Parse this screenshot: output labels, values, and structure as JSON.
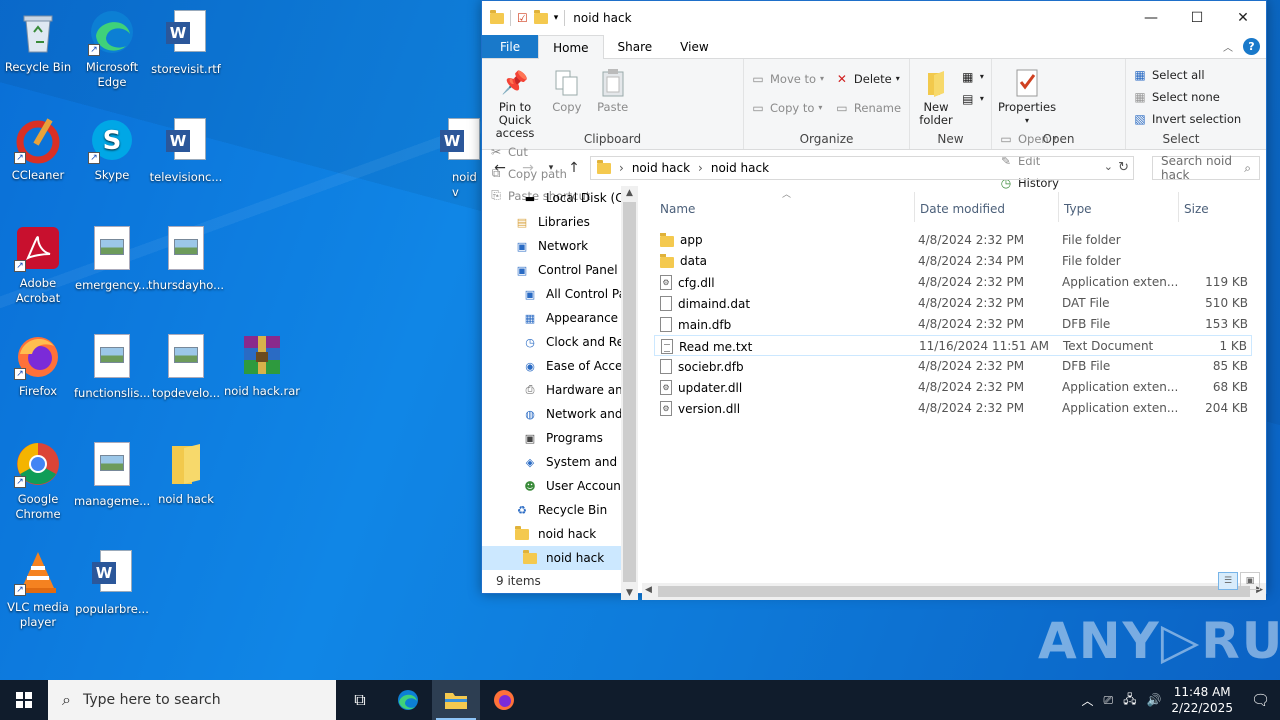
{
  "desktop": {
    "icons": [
      {
        "label": "Recycle Bin"
      },
      {
        "label": "Microsoft Edge"
      },
      {
        "label": "storevisit.rtf"
      },
      {
        "label": "CCleaner"
      },
      {
        "label": "Skype"
      },
      {
        "label": "televisionc..."
      },
      {
        "label": "noid v"
      },
      {
        "label": "Adobe Acrobat"
      },
      {
        "label": "emergency..."
      },
      {
        "label": "thursdayho..."
      },
      {
        "label": "Firefox"
      },
      {
        "label": "functionslis..."
      },
      {
        "label": "topdevelo..."
      },
      {
        "label": "noid hack.rar"
      },
      {
        "label": "Google Chrome"
      },
      {
        "label": "manageme..."
      },
      {
        "label": "noid hack"
      },
      {
        "label": "VLC media player"
      },
      {
        "label": "popularbre..."
      }
    ]
  },
  "window": {
    "title": "noid hack",
    "caption": {
      "minimize": "—",
      "maximize": "☐",
      "close": "✕"
    },
    "tabs": [
      "File",
      "Home",
      "Share",
      "View"
    ],
    "ribbon": {
      "clipboard": {
        "name": "Clipboard",
        "pin": "Pin to Quick access",
        "copy": "Copy",
        "paste": "Paste",
        "cut": "Cut",
        "copy_path": "Copy path",
        "paste_shortcut": "Paste shortcut"
      },
      "organize": {
        "name": "Organize",
        "move_to": "Move to",
        "copy_to": "Copy to",
        "delete": "Delete",
        "rename": "Rename"
      },
      "new": {
        "name": "New",
        "new_folder": "New folder"
      },
      "open": {
        "name": "Open",
        "properties": "Properties",
        "open": "Open",
        "edit": "Edit",
        "history": "History"
      },
      "select": {
        "name": "Select",
        "select_all": "Select all",
        "select_none": "Select none",
        "invert": "Invert selection"
      }
    },
    "address": {
      "crumbs": [
        "noid hack",
        "noid hack"
      ],
      "search_placeholder": "Search noid hack"
    },
    "nav": [
      {
        "label": "Local Disk (C:)"
      },
      {
        "label": "Libraries"
      },
      {
        "label": "Network"
      },
      {
        "label": "Control Panel"
      },
      {
        "label": "All Control Par"
      },
      {
        "label": "Appearance an"
      },
      {
        "label": "Clock and Regi"
      },
      {
        "label": "Ease of Access"
      },
      {
        "label": "Hardware and"
      },
      {
        "label": "Network and Ir"
      },
      {
        "label": "Programs"
      },
      {
        "label": "System and Sec"
      },
      {
        "label": "User Accounts"
      },
      {
        "label": "Recycle Bin"
      },
      {
        "label": "noid hack"
      },
      {
        "label": "noid hack"
      }
    ],
    "columns": {
      "name": "Name",
      "date": "Date modified",
      "type": "Type",
      "size": "Size"
    },
    "files": [
      {
        "name": "app",
        "date": "4/8/2024 2:32 PM",
        "type": "File folder",
        "size": ""
      },
      {
        "name": "data",
        "date": "4/8/2024 2:34 PM",
        "type": "File folder",
        "size": ""
      },
      {
        "name": "cfg.dll",
        "date": "4/8/2024 2:32 PM",
        "type": "Application exten...",
        "size": "119 KB"
      },
      {
        "name": "dimaind.dat",
        "date": "4/8/2024 2:32 PM",
        "type": "DAT File",
        "size": "510 KB"
      },
      {
        "name": "main.dfb",
        "date": "4/8/2024 2:32 PM",
        "type": "DFB File",
        "size": "153 KB"
      },
      {
        "name": "Read me.txt",
        "date": "11/16/2024 11:51 AM",
        "type": "Text Document",
        "size": "1 KB"
      },
      {
        "name": "sociebr.dfb",
        "date": "4/8/2024 2:32 PM",
        "type": "DFB File",
        "size": "85 KB"
      },
      {
        "name": "updater.dll",
        "date": "4/8/2024 2:32 PM",
        "type": "Application exten...",
        "size": "68 KB"
      },
      {
        "name": "version.dll",
        "date": "4/8/2024 2:32 PM",
        "type": "Application exten...",
        "size": "204 KB"
      }
    ],
    "status": "9 items"
  },
  "watermark": "ANY▷RUN",
  "taskbar": {
    "search_placeholder": "Type here to search",
    "time": "11:48 AM",
    "date": "2/22/2025"
  }
}
